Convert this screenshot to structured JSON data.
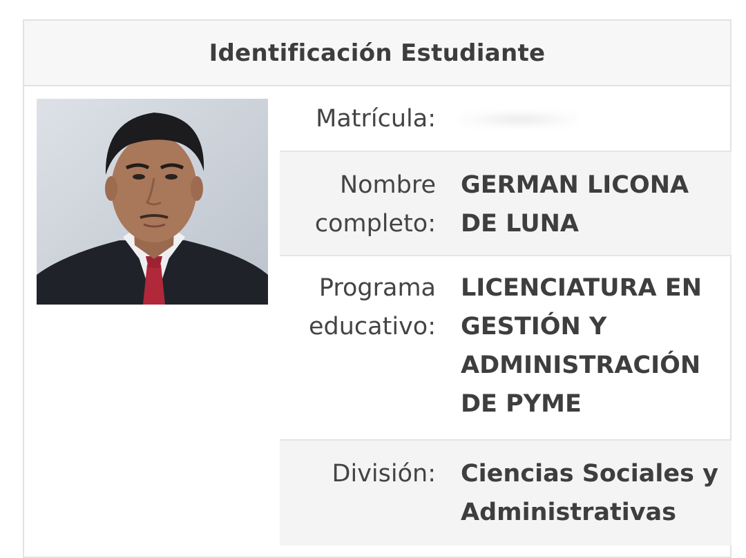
{
  "header": {
    "title": "Identificación Estudiante"
  },
  "student": {
    "photo_alt": "",
    "fields": [
      {
        "label": "Matrícula:",
        "value": ""
      },
      {
        "label": "Nombre completo:",
        "value": "GERMAN LICONA DE LUNA"
      },
      {
        "label": "Programa educativo:",
        "value": "LICENCIATURA EN GESTIÓN Y ADMINISTRACIÓN DE PYME"
      },
      {
        "label": "División:",
        "value": "Ciencias Sociales y Administrativas"
      }
    ]
  },
  "colors": {
    "header_bg": "#f7f7f7",
    "shaded_row_bg": "#f4f4f4",
    "border": "#e2e2e2",
    "text": "#3e3e3e",
    "tie": "#b0283a",
    "suit": "#1f2329"
  }
}
